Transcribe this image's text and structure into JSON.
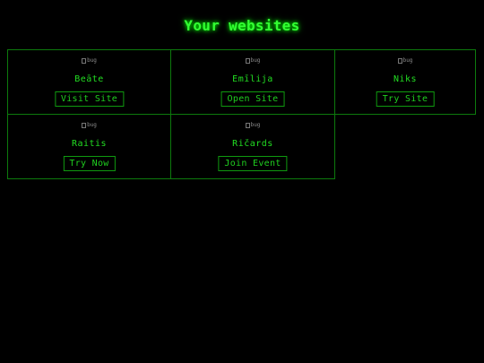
{
  "page": {
    "title": "Your websites"
  },
  "sites": [
    {
      "image_alt": "bug",
      "name": "Beāte",
      "button_label": "Visit Site"
    },
    {
      "image_alt": "bug",
      "name": "Emīlija",
      "button_label": "Open Site"
    },
    {
      "image_alt": "bug",
      "name": "Niks",
      "button_label": "Try Site"
    },
    {
      "image_alt": "bug",
      "name": "Raitis",
      "button_label": "Try Now"
    },
    {
      "image_alt": "bug",
      "name": "Ričards",
      "button_label": "Join Event"
    }
  ],
  "colors": {
    "background": "#000000",
    "accent": "#33ff33",
    "border": "#0d7a0d"
  }
}
